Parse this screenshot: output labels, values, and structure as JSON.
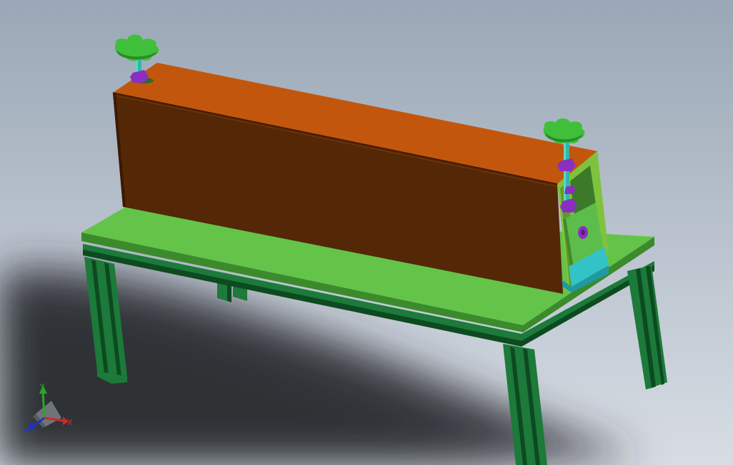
{
  "viewport": {
    "background_top": "#9aa7b6",
    "background_bottom": "#d8dde4",
    "shadow_color": "#2c2e33"
  },
  "model": {
    "box_front": "#542706",
    "box_top": "#c2560d",
    "box_edge": "#3b1904",
    "table_top": "#63c449",
    "table_edge": "#3b8a2c",
    "frame_color": "#1c7a3a",
    "frame_dark": "#0d4a20",
    "knob_color": "#3fbf3a",
    "screw_color": "#33b7a6",
    "nut_color": "#8b2fc0",
    "bracket_color": "#7fc23e",
    "block_color": "#5dbd4a",
    "base_block_color": "#33c2c6"
  },
  "triad": {
    "labels": {
      "x": "X",
      "y": "Y",
      "z": "Z"
    },
    "colors": {
      "x": "#d22727",
      "y": "#2aa52a",
      "z": "#2230c8"
    }
  }
}
